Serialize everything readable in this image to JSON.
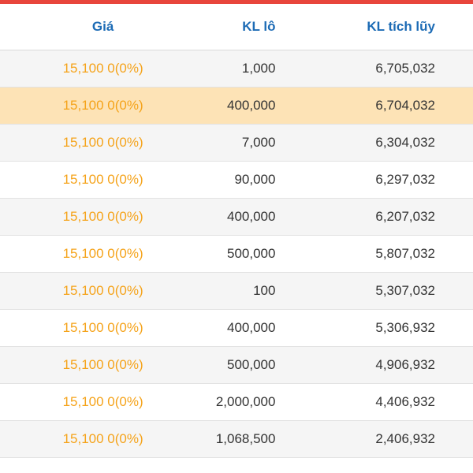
{
  "header": {
    "price": "Giá",
    "lot_volume": "KL lô",
    "cumulative_volume": "KL tích lũy"
  },
  "colors": {
    "accent_bar": "#e8453c",
    "header_text": "#1c6bb5",
    "price_text": "#f5a31a",
    "selected_row": "#fde3b6"
  },
  "rows": [
    {
      "price": "15,100 0(0%)",
      "lot": "1,000",
      "cumulative": "6,705,032"
    },
    {
      "price": "15,100 0(0%)",
      "lot": "400,000",
      "cumulative": "6,704,032"
    },
    {
      "price": "15,100 0(0%)",
      "lot": "7,000",
      "cumulative": "6,304,032"
    },
    {
      "price": "15,100 0(0%)",
      "lot": "90,000",
      "cumulative": "6,297,032"
    },
    {
      "price": "15,100 0(0%)",
      "lot": "400,000",
      "cumulative": "6,207,032"
    },
    {
      "price": "15,100 0(0%)",
      "lot": "500,000",
      "cumulative": "5,807,032"
    },
    {
      "price": "15,100 0(0%)",
      "lot": "100",
      "cumulative": "5,307,032"
    },
    {
      "price": "15,100 0(0%)",
      "lot": "400,000",
      "cumulative": "5,306,932"
    },
    {
      "price": "15,100 0(0%)",
      "lot": "500,000",
      "cumulative": "4,906,932"
    },
    {
      "price": "15,100 0(0%)",
      "lot": "2,000,000",
      "cumulative": "4,406,932"
    },
    {
      "price": "15,100 0(0%)",
      "lot": "1,068,500",
      "cumulative": "2,406,932"
    }
  ]
}
